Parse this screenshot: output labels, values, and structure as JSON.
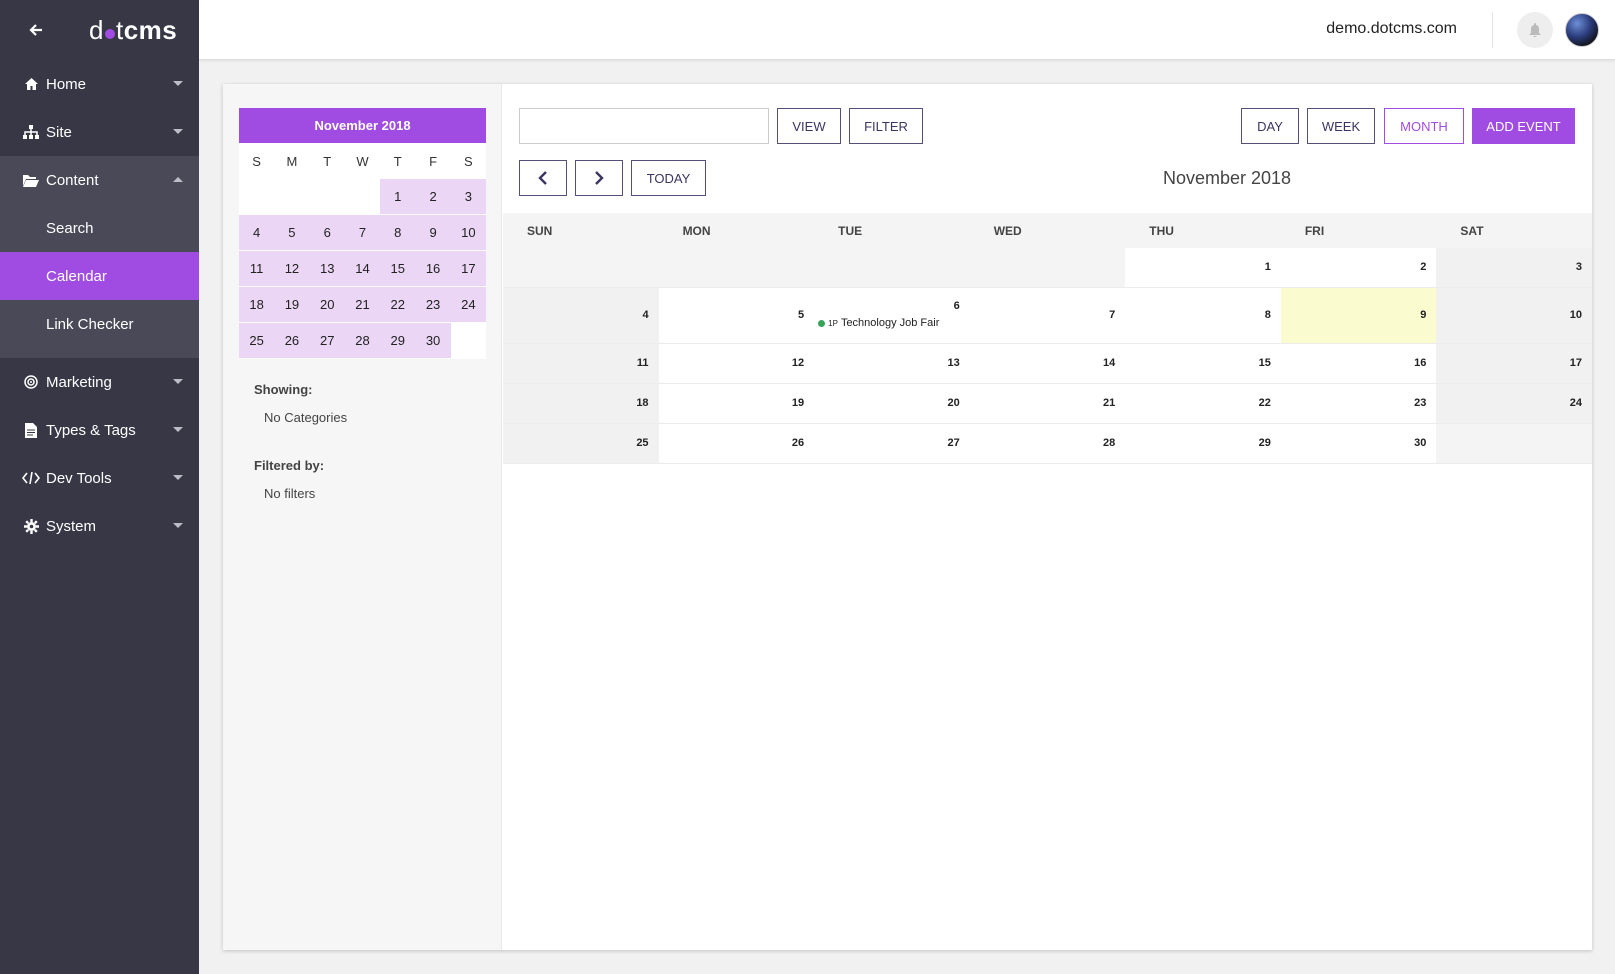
{
  "sidebar": {
    "logo_part1": "d",
    "logo_part2": "t",
    "logo_part3": "cms",
    "items": [
      {
        "label": "Home",
        "icon": "home-icon"
      },
      {
        "label": "Site",
        "icon": "sitemap-icon"
      },
      {
        "label": "Content",
        "icon": "folder-open-icon"
      },
      {
        "label": "Marketing",
        "icon": "target-icon"
      },
      {
        "label": "Types & Tags",
        "icon": "file-text-icon"
      },
      {
        "label": "Dev Tools",
        "icon": "code-icon"
      },
      {
        "label": "System",
        "icon": "gear-icon"
      }
    ],
    "content_sub": [
      {
        "label": "Search"
      },
      {
        "label": "Calendar",
        "active": true
      },
      {
        "label": "Link Checker"
      }
    ]
  },
  "header": {
    "site_name": "demo.dotcms.com"
  },
  "mini_calendar": {
    "title": "November 2018",
    "weekday_headers": [
      "S",
      "M",
      "T",
      "W",
      "T",
      "F",
      "S"
    ],
    "leading_blanks": 4,
    "days": [
      "1",
      "2",
      "3",
      "4",
      "5",
      "6",
      "7",
      "8",
      "9",
      "10",
      "11",
      "12",
      "13",
      "14",
      "15",
      "16",
      "17",
      "18",
      "19",
      "20",
      "21",
      "22",
      "23",
      "24",
      "25",
      "26",
      "27",
      "28",
      "29",
      "30"
    ]
  },
  "filters": {
    "showing_label": "Showing:",
    "showing_value": "No Categories",
    "filtered_label": "Filtered by:",
    "filtered_value": "No filters"
  },
  "toolbar": {
    "search_value": "",
    "view_label": "VIEW",
    "filter_label": "FILTER",
    "day_label": "DAY",
    "week_label": "WEEK",
    "month_label": "MONTH",
    "add_event_label": "ADD EVENT",
    "today_label": "TODAY",
    "accent_color": "#a04ce3"
  },
  "calendar": {
    "title": "November 2018",
    "weekday_headers": [
      "SUN",
      "MON",
      "TUE",
      "WED",
      "THU",
      "FRI",
      "SAT"
    ],
    "weeks": [
      [
        "",
        "",
        "",
        "",
        "1",
        "2",
        "3"
      ],
      [
        "4",
        "5",
        "6",
        "7",
        "8",
        "9",
        "10"
      ],
      [
        "11",
        "12",
        "13",
        "14",
        "15",
        "16",
        "17"
      ],
      [
        "18",
        "19",
        "20",
        "21",
        "22",
        "23",
        "24"
      ],
      [
        "25",
        "26",
        "27",
        "28",
        "29",
        "30",
        ""
      ]
    ],
    "today": "9",
    "events": [
      {
        "day": "6",
        "time": "1P",
        "title": "Technology Job Fair",
        "status_color": "#3aa35a"
      }
    ]
  }
}
